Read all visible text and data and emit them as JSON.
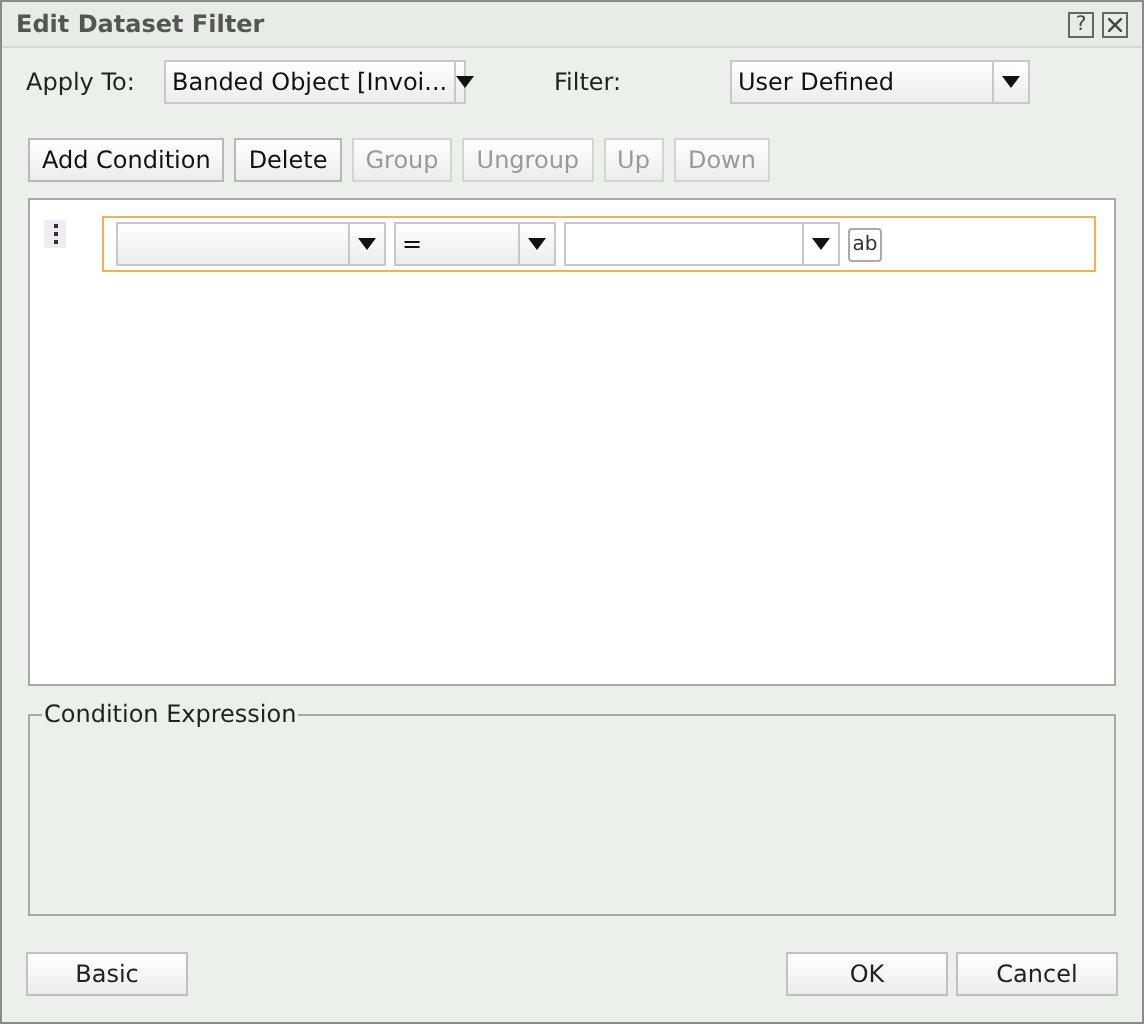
{
  "window": {
    "title": "Edit Dataset Filter",
    "help": "?"
  },
  "apply_to": {
    "label": "Apply To:",
    "value": "Banded Object [Invoi..."
  },
  "filter": {
    "label": "Filter:",
    "value": "User Defined"
  },
  "toolbar": [
    {
      "label": "Add Condition",
      "disabled": false
    },
    {
      "label": "Delete",
      "disabled": false
    },
    {
      "label": "Group",
      "disabled": true
    },
    {
      "label": "Ungroup",
      "disabled": true
    },
    {
      "label": "Up",
      "disabled": true
    },
    {
      "label": "Down",
      "disabled": true
    }
  ],
  "conditions": [
    {
      "selected": true,
      "operator": "=",
      "value_type": "ab"
    }
  ],
  "expression": {
    "legend": "Condition Expression"
  },
  "buttons": {
    "basic": "Basic",
    "ok": "OK",
    "cancel": "Cancel"
  }
}
